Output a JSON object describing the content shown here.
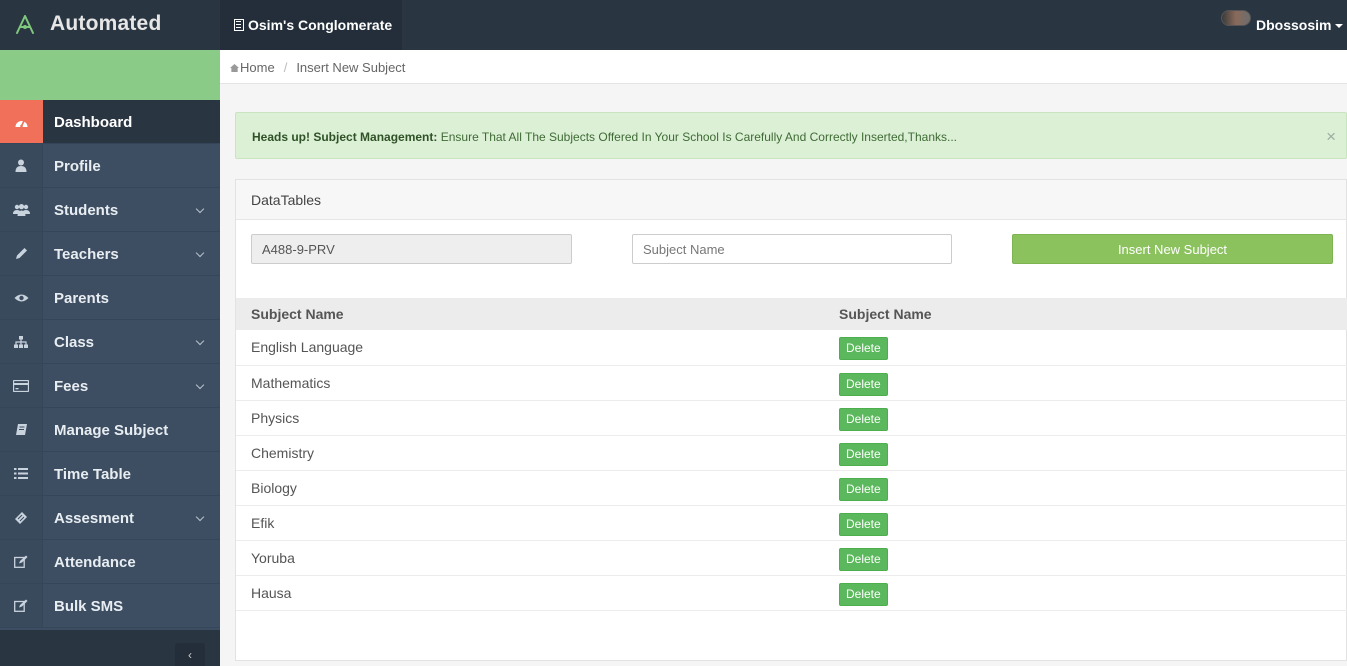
{
  "header": {
    "brand": "Automated",
    "org_name": "Osim's Conglomerate",
    "user_name": "Dbossosim"
  },
  "sidebar": {
    "items": [
      {
        "label": "Dashboard",
        "icon": "dashboard-icon",
        "has_children": false,
        "active": true,
        "stripe": "#f0705a"
      },
      {
        "label": "Profile",
        "icon": "user-icon",
        "has_children": false,
        "active": false,
        "stripe": "#6b7f96"
      },
      {
        "label": "Students",
        "icon": "users-icon",
        "has_children": true,
        "active": false,
        "stripe": "#4a90c2"
      },
      {
        "label": "Teachers",
        "icon": "pencil-icon",
        "has_children": true,
        "active": false,
        "stripe": "#8a6dbf"
      },
      {
        "label": "Parents",
        "icon": "eye-icon",
        "has_children": false,
        "active": false,
        "stripe": "#4ab3b0"
      },
      {
        "label": "Class",
        "icon": "sitemap-icon",
        "has_children": true,
        "active": false,
        "stripe": "#e6a23c"
      },
      {
        "label": "Fees",
        "icon": "credit-card-icon",
        "has_children": true,
        "active": false,
        "stripe": "#6cbf6c"
      },
      {
        "label": "Manage Subject",
        "icon": "book-icon",
        "has_children": false,
        "active": false,
        "stripe": "#c2a44a"
      },
      {
        "label": "Time Table",
        "icon": "list-icon",
        "has_children": false,
        "active": false,
        "stripe": "#c24a6e"
      },
      {
        "label": "Assesment",
        "icon": "ticket-icon",
        "has_children": true,
        "active": false,
        "stripe": "#4a6ec2"
      },
      {
        "label": "Attendance",
        "icon": "edit-icon",
        "has_children": false,
        "active": false,
        "stripe": "#c28a4a"
      },
      {
        "label": "Bulk SMS",
        "icon": "edit-icon",
        "has_children": false,
        "active": false,
        "stripe": "#e0c040"
      }
    ],
    "collapse_label": "‹"
  },
  "breadcrumb": {
    "home": "Home",
    "separator": "/",
    "current": "Insert New Subject"
  },
  "alert": {
    "title": "Heads up! Subject Management:",
    "message": "Ensure That All The Subjects Offered In Your School Is Carefully And Correctly Inserted,Thanks...",
    "close": "×"
  },
  "panel": {
    "title": "DataTables",
    "school_code": "A488-9-PRV",
    "subject_placeholder": "Subject Name",
    "insert_button": "Insert New Subject",
    "columns": [
      "Subject Name",
      "Subject Name"
    ],
    "delete_label": "Delete",
    "rows": [
      "English Language",
      "Mathematics",
      "Physics",
      "Chemistry",
      "Biology",
      "Efik",
      "Yoruba",
      "Hausa"
    ]
  },
  "colors": {
    "topbar": "#2a3542",
    "sidebar": "#3d4e62",
    "accent_green": "#8acb88",
    "active_icon": "#f0705a",
    "insert_button": "#8bc25e",
    "delete_button": "#5cb85c"
  }
}
